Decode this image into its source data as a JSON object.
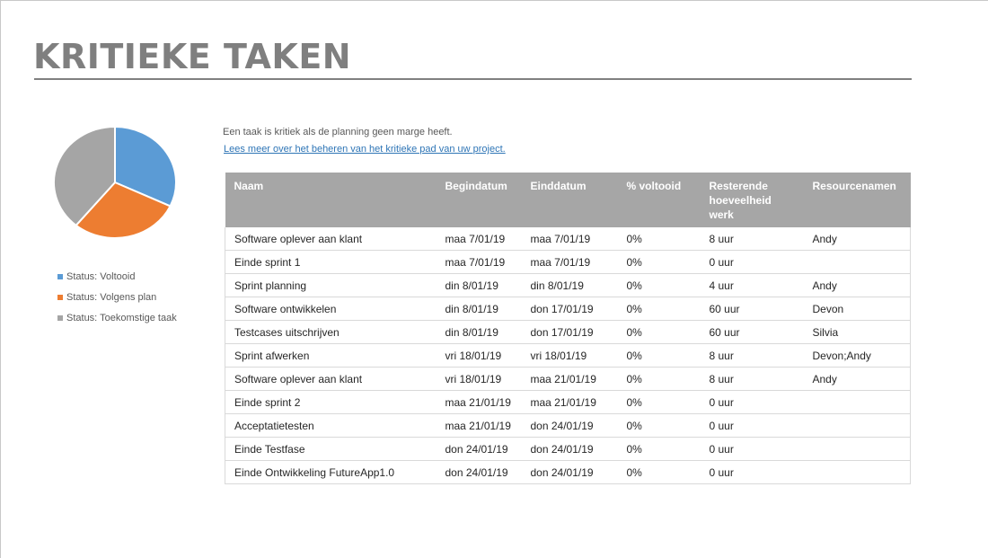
{
  "page": {
    "title": "KRITIEKE TAKEN",
    "intro": "Een taak is kritiek als de planning geen marge heeft.",
    "link": "Lees meer over het beheren van het kritieke pad van uw project."
  },
  "chart_data": {
    "type": "pie",
    "categories": [
      "Status: Voltooid",
      "Status: Volgens plan",
      "Status: Toekomstige taak"
    ],
    "values": [
      32,
      29,
      39
    ],
    "colors": [
      "#5b9bd5",
      "#ed7d31",
      "#a5a5a5"
    ],
    "legend_position": "bottom",
    "title": ""
  },
  "table": {
    "headers": [
      "Naam",
      "Begindatum",
      "Einddatum",
      "% voltooid",
      "Resterende hoeveelheid werk",
      "Resourcenamen"
    ],
    "rows": [
      [
        "Software oplever aan klant",
        "maa 7/01/19",
        "maa 7/01/19",
        "0%",
        "8 uur",
        "Andy"
      ],
      [
        "Einde sprint 1",
        "maa 7/01/19",
        "maa 7/01/19",
        "0%",
        "0 uur",
        ""
      ],
      [
        "Sprint planning",
        "din 8/01/19",
        "din 8/01/19",
        "0%",
        "4 uur",
        "Andy"
      ],
      [
        "Software ontwikkelen",
        "din 8/01/19",
        "don 17/01/19",
        "0%",
        "60 uur",
        "Devon"
      ],
      [
        "Testcases uitschrijven",
        "din 8/01/19",
        "don 17/01/19",
        "0%",
        "60 uur",
        "Silvia"
      ],
      [
        "Sprint afwerken",
        "vri 18/01/19",
        "vri 18/01/19",
        "0%",
        "8 uur",
        "Devon;Andy"
      ],
      [
        "Software oplever aan klant",
        "vri 18/01/19",
        "maa 21/01/19",
        "0%",
        "8 uur",
        "Andy"
      ],
      [
        "Einde sprint 2",
        "maa 21/01/19",
        "maa 21/01/19",
        "0%",
        "0 uur",
        ""
      ],
      [
        "Acceptatietesten",
        "maa 21/01/19",
        "don 24/01/19",
        "0%",
        "0 uur",
        ""
      ],
      [
        "Einde Testfase",
        "don 24/01/19",
        "don 24/01/19",
        "0%",
        "0 uur",
        ""
      ],
      [
        "Einde Ontwikkeling FutureApp1.0",
        "don 24/01/19",
        "don 24/01/19",
        "0%",
        "0 uur",
        ""
      ]
    ]
  }
}
